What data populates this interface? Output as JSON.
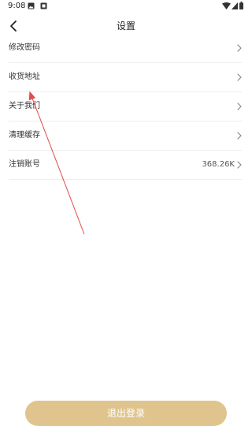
{
  "status_bar": {
    "time": "9:08",
    "left_icons": [
      "image-icon",
      "notification-icon"
    ],
    "right_icons": [
      "wifi-icon",
      "signal-icon",
      "battery-icon"
    ]
  },
  "header": {
    "back_icon": "chevron-left-icon",
    "title": "设置"
  },
  "settings": {
    "items": [
      {
        "label": "修改密码",
        "value": "",
        "icon": "chevron-right-icon"
      },
      {
        "label": "收货地址",
        "value": "",
        "icon": "chevron-right-icon"
      },
      {
        "label": "关于我们",
        "value": "",
        "icon": "chevron-right-icon"
      },
      {
        "label": "清理缓存",
        "value": "",
        "icon": "chevron-right-icon"
      },
      {
        "label": "注销账号",
        "value": "368.26K",
        "icon": "chevron-right-icon"
      }
    ]
  },
  "footer": {
    "logout_label": "退出登录"
  },
  "colors": {
    "accent": "#dfc58d",
    "annotation": "#e04c4c",
    "divider": "#eeeeee"
  }
}
